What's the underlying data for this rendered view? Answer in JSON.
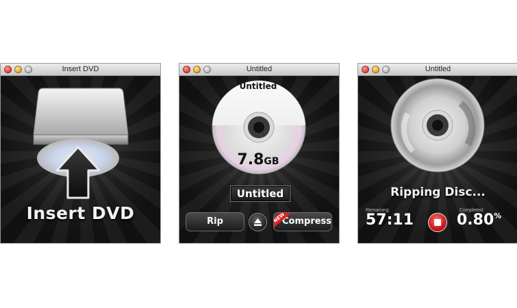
{
  "windows": [
    {
      "title": "Insert DVD",
      "label": "Insert DVD"
    },
    {
      "title": "Untitled",
      "disc_title": "Untitled",
      "size_value": "7.8",
      "size_unit": "GB",
      "name_field_value": "Untitled",
      "rip_label": "Rip",
      "compress_label": "Compress",
      "new_badge": "NEW"
    },
    {
      "title": "Untitled",
      "status": "Ripping Disc...",
      "remaining_caption": "Remaining:",
      "remaining_value": "57:11",
      "completed_caption": "Completed:",
      "completed_value": "0.80",
      "completed_unit": "%"
    }
  ],
  "colors": {
    "stop_red": "#c41515",
    "background": "#000000",
    "titlebar": "#d8d8d8"
  },
  "icons": [
    "close-icon",
    "minimize-icon",
    "zoom-icon",
    "dvd-drive-icon",
    "disc-icon",
    "up-arrow-icon",
    "eject-icon",
    "stop-icon"
  ]
}
